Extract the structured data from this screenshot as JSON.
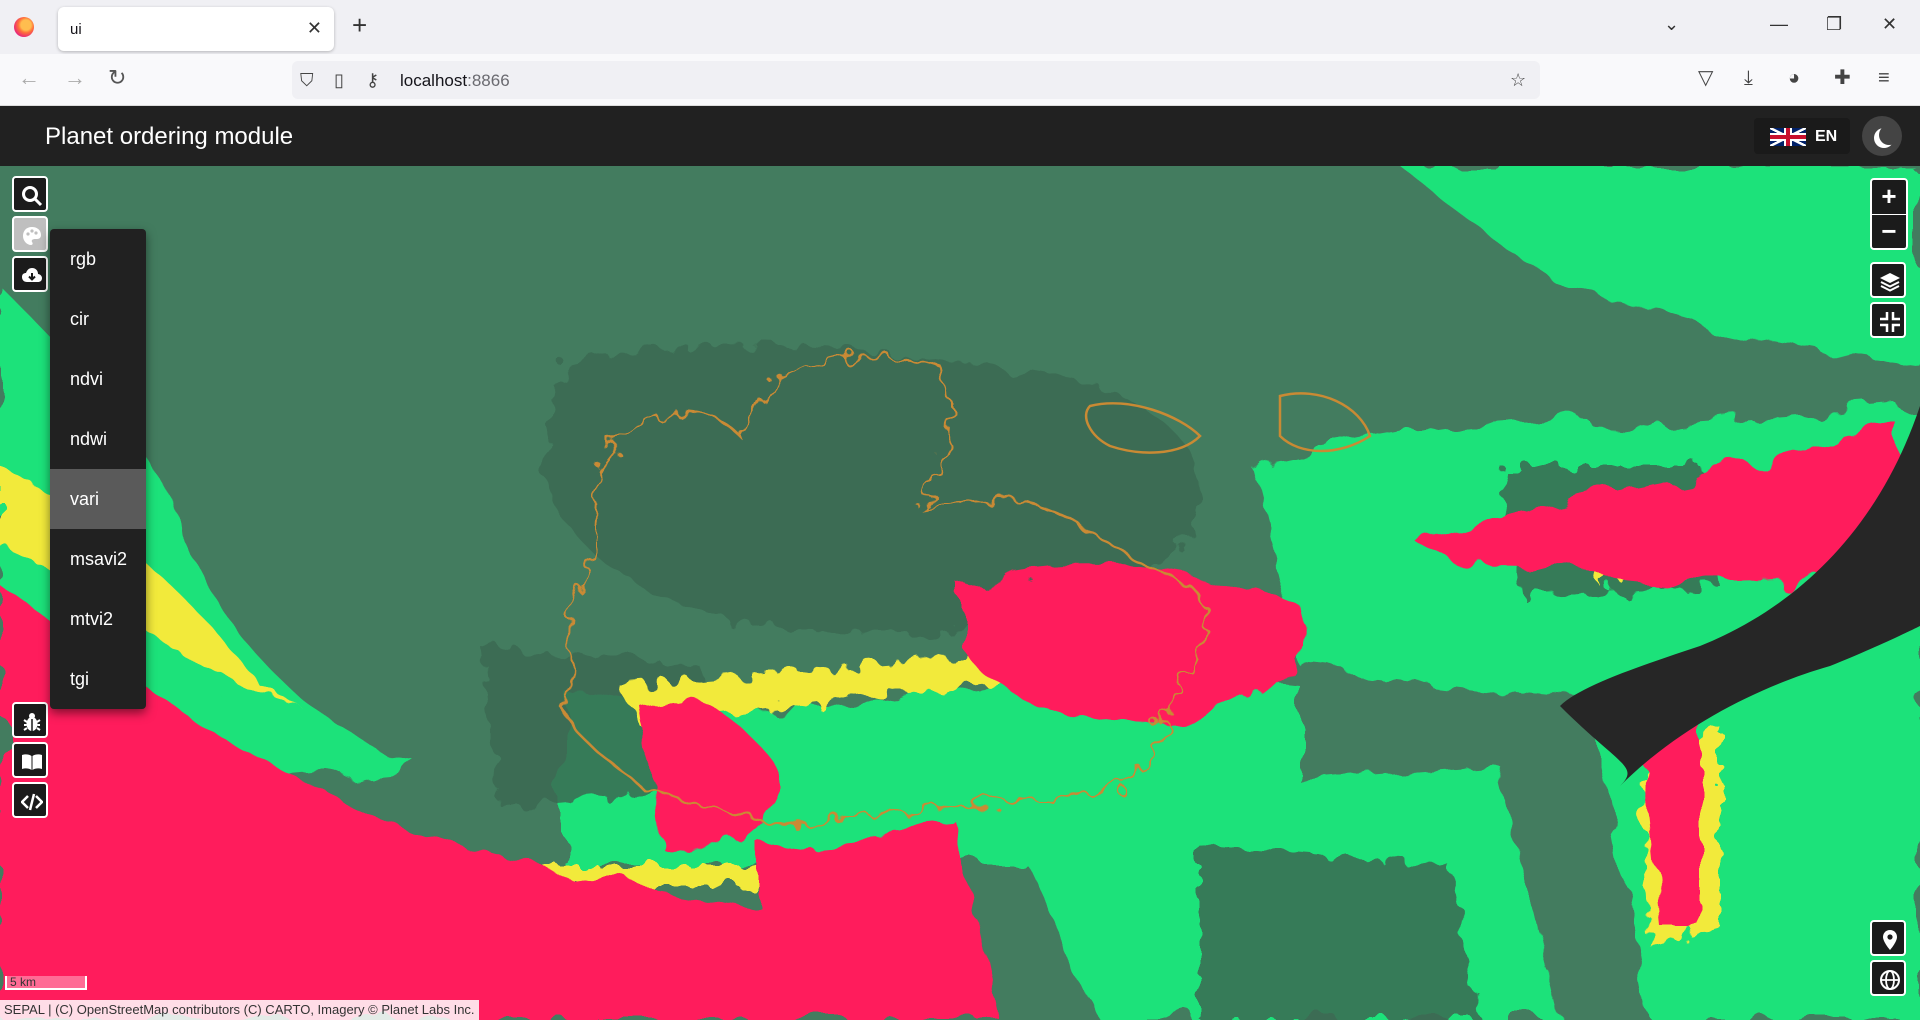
{
  "browser": {
    "tab_title": "ui",
    "tab_close": "✕",
    "new_tab": "+",
    "url_host": "localhost",
    "url_port": ":8866"
  },
  "app": {
    "title": "Planet ordering module",
    "lang_code": "EN"
  },
  "visualization_menu": {
    "items": [
      {
        "label": "rgb"
      },
      {
        "label": "cir"
      },
      {
        "label": "ndvi"
      },
      {
        "label": "ndwi"
      },
      {
        "label": "vari"
      },
      {
        "label": "msavi2"
      },
      {
        "label": "mtvi2"
      },
      {
        "label": "tgi"
      }
    ],
    "selected": "vari"
  },
  "map": {
    "zoom_in": "+",
    "zoom_out": "−",
    "scale_label": "5 km",
    "attribution": "SEPAL | (C) OpenStreetMap contributors (C) CARTO, Imagery © Planet Labs Inc."
  },
  "colors": {
    "appbar": "#212121",
    "index_high": "#00e676",
    "index_low": "#ff1a5c",
    "index_mid": "#ffee33"
  }
}
